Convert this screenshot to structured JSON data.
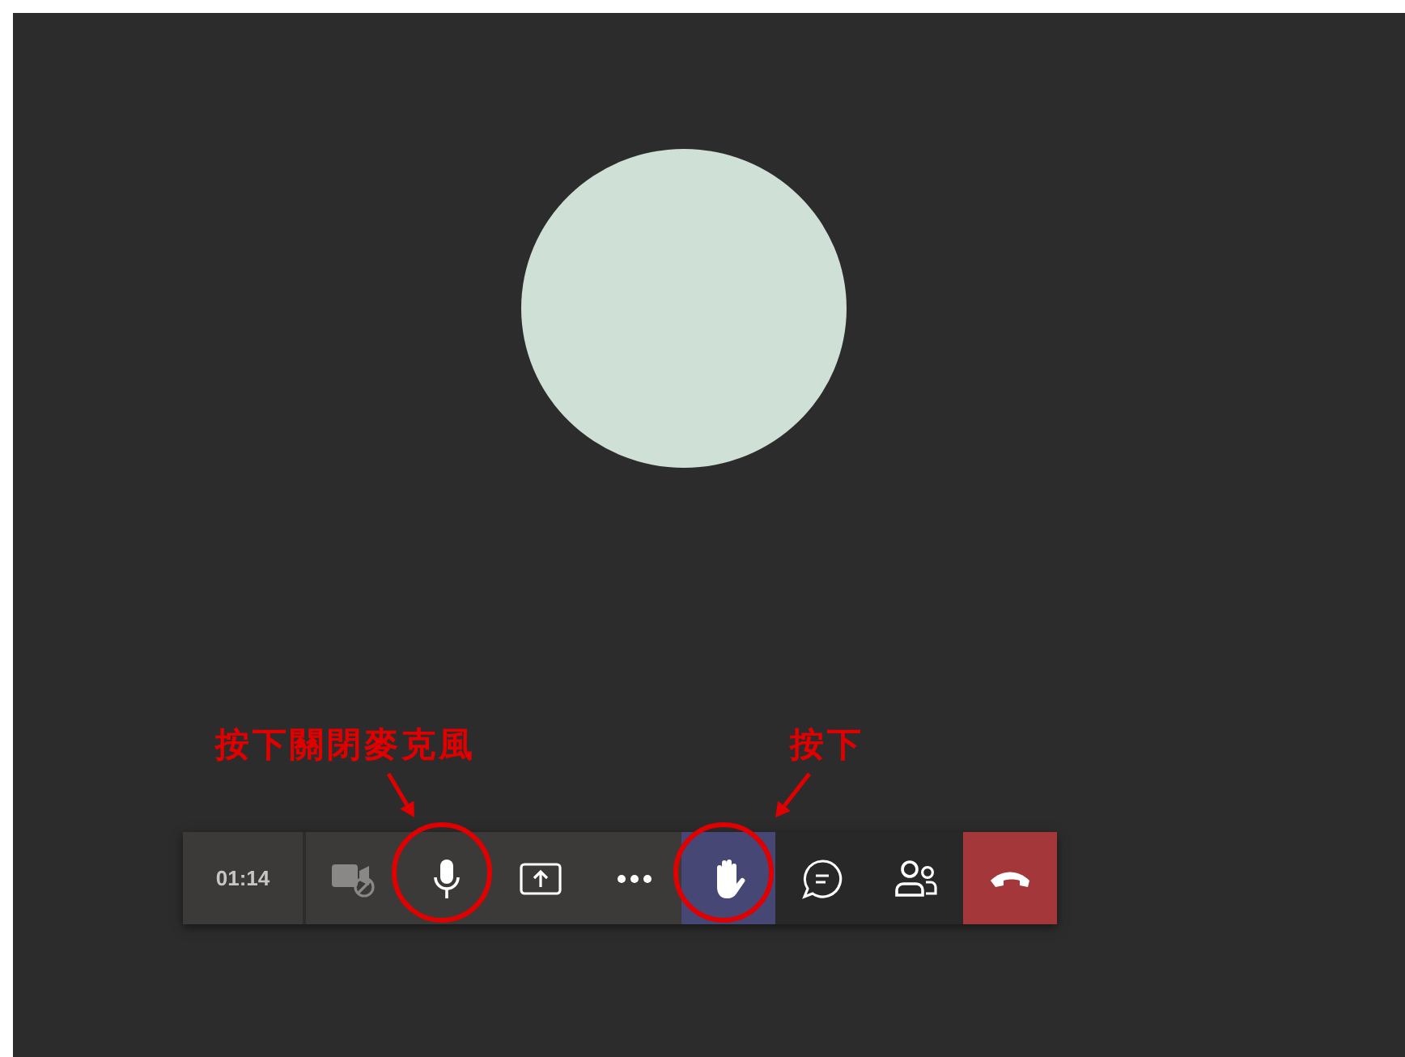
{
  "call": {
    "timer": "01:14",
    "buttons": [
      {
        "kind": "camera",
        "disabled": true,
        "selected": false,
        "circled": false
      },
      {
        "kind": "mic",
        "disabled": false,
        "selected": false,
        "circled": true
      },
      {
        "kind": "share",
        "disabled": false,
        "selected": false,
        "circled": false
      },
      {
        "kind": "more",
        "disabled": false,
        "selected": false,
        "circled": false
      },
      {
        "kind": "hand",
        "disabled": false,
        "selected": true,
        "circled": true
      },
      {
        "kind": "chat",
        "disabled": false,
        "selected": false,
        "circled": false
      },
      {
        "kind": "people",
        "disabled": false,
        "selected": false,
        "circled": false
      },
      {
        "kind": "hangup",
        "disabled": false,
        "selected": false,
        "circled": false
      }
    ]
  },
  "annotations": [
    {
      "text": "按下關閉麥克風"
    },
    {
      "text": "按下"
    }
  ]
}
